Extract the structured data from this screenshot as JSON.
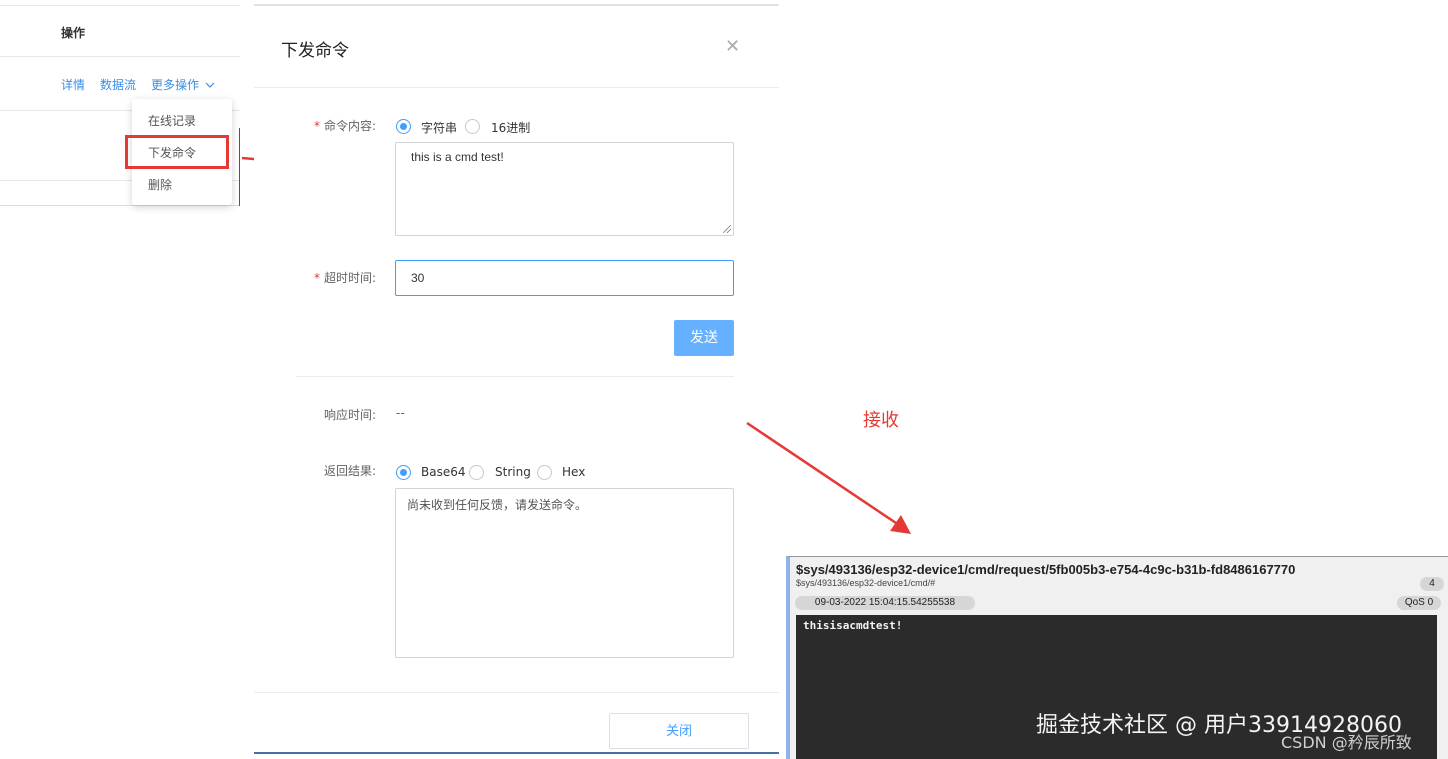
{
  "table": {
    "column_header": "操作",
    "row_actions": [
      "详情",
      "数据流",
      "更多操作"
    ],
    "more_menu": [
      "在线记录",
      "下发命令",
      "删除"
    ]
  },
  "modal": {
    "title": "下发命令",
    "command_label": "命令内容:",
    "command_formats": [
      "字符串",
      "16进制"
    ],
    "command_format_selected": "字符串",
    "command_text": "this is  a  cmd test!",
    "timeout_label": "超时时间:",
    "timeout_value": "30",
    "send_button": "发送",
    "response_time_label": "响应时间:",
    "response_time_value": "--",
    "result_label": "返回结果:",
    "result_formats": [
      "Base64",
      "String",
      "Hex"
    ],
    "result_format_selected": "Base64",
    "result_text": "尚未收到任何反馈，请发送命令。",
    "close_button": "关闭"
  },
  "annotation": {
    "receive_label": "接收",
    "arrow_color": "#e53935"
  },
  "mqtt_message": {
    "topic": "$sys/493136/esp32-device1/cmd/request/5fb005b3-e754-4c9c-b31b-fd8486167770",
    "subscription": "$sys/493136/esp32-device1/cmd/#",
    "count": "4",
    "timestamp": "09-03-2022  15:04:15.54255538",
    "qos": "QoS 0",
    "payload": "thisisacmdtest!"
  },
  "watermark": {
    "line1": "掘金技术社区 @ 用户33914928060",
    "line2": "CSDN @矜辰所致"
  },
  "colors": {
    "accent": "#409eff",
    "highlight_box": "#e53935",
    "payload_bg": "#2b2b2b"
  }
}
